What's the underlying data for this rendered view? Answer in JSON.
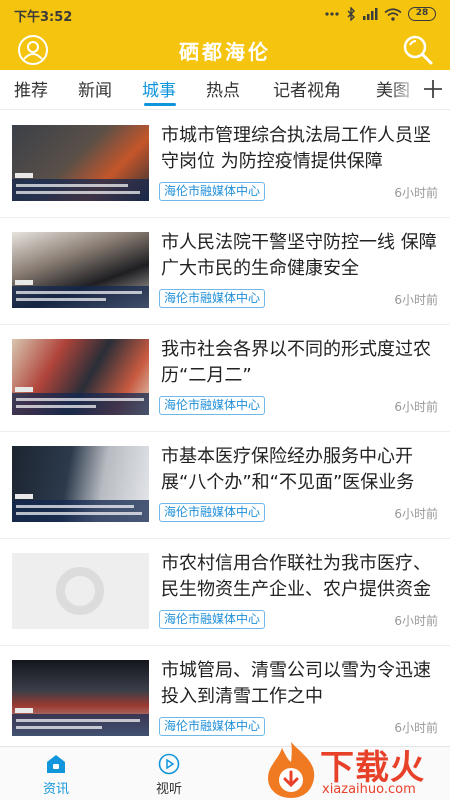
{
  "status": {
    "time": "下午3:52",
    "battery": "28"
  },
  "header": {
    "title": "硒都海伦"
  },
  "tabs": [
    {
      "label": "推荐"
    },
    {
      "label": "新闻"
    },
    {
      "label": "城事"
    },
    {
      "label": "热点"
    },
    {
      "label": "记者视角"
    },
    {
      "label": "美图"
    }
  ],
  "active_tab": "城事",
  "articles": [
    {
      "title": "市城市管理综合执法局工作人员坚守岗位 为防控疫情提供保障",
      "source": "海伦市融媒体中心",
      "time": "6小时前"
    },
    {
      "title": "市人民法院干警坚守防控一线 保障广大市民的生命健康安全",
      "source": "海伦市融媒体中心",
      "time": "6小时前"
    },
    {
      "title": "我市社会各界以不同的形式度过农历“二月二”",
      "source": "海伦市融媒体中心",
      "time": "6小时前"
    },
    {
      "title": "市基本医疗保险经办服务中心开展“八个办”和“不见面”医保业务",
      "source": "海伦市融媒体中心",
      "time": "6小时前"
    },
    {
      "title": "市农村信用合作联社为我市医疗、民生物资生产企业、农户提供资金",
      "source": "海伦市融媒体中心",
      "time": "6小时前"
    },
    {
      "title": "市城管局、清雪公司以雪为令迅速投入到清雪工作之中",
      "source": "海伦市融媒体中心",
      "time": "6小时前"
    }
  ],
  "bottom_nav": [
    {
      "label": "资讯",
      "icon": "news-icon"
    },
    {
      "label": "视听",
      "icon": "play-icon"
    }
  ],
  "watermark": {
    "text": "下载火",
    "url": "xiazaihuo.com"
  },
  "colors": {
    "header": "#f5c40f",
    "accent": "#1296db"
  }
}
